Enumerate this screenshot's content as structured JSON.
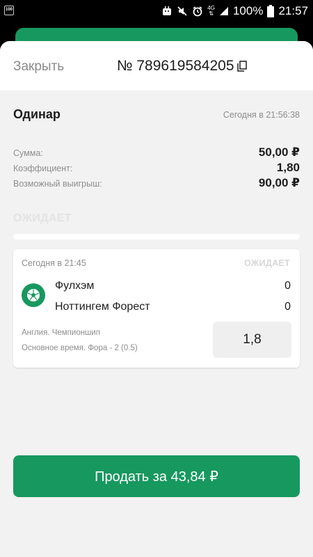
{
  "status_bar": {
    "left_badge": "100",
    "network": "4G",
    "battery_percent": "100%",
    "time": "21:57"
  },
  "header": {
    "close_label": "Закрыть",
    "bet_number": "№ 789619584205"
  },
  "bet": {
    "type": "Одинар",
    "time": "Сегодня в 21:56:38",
    "sum_label": "Сумма:",
    "sum_value": "50,00 ₽",
    "coef_label": "Коэффициент:",
    "coef_value": "1,80",
    "win_label": "Возможный выигрыш:",
    "win_value": "90,00 ₽",
    "status": "ОЖИДАЕТ"
  },
  "event": {
    "time": "Сегодня в 21:45",
    "status": "ОЖИДАЕТ",
    "team1": "Фулхэм",
    "score1": "0",
    "team2": "Ноттингем Форест",
    "score2": "0",
    "league": "Англия. Чемпионшип",
    "market": "Основное время. Фора - 2 (0.5)",
    "odds": "1,8"
  },
  "actions": {
    "sell_label": "Продать за 43,84 ₽"
  },
  "colors": {
    "accent": "#17985f",
    "background": "#f2f2f2"
  }
}
